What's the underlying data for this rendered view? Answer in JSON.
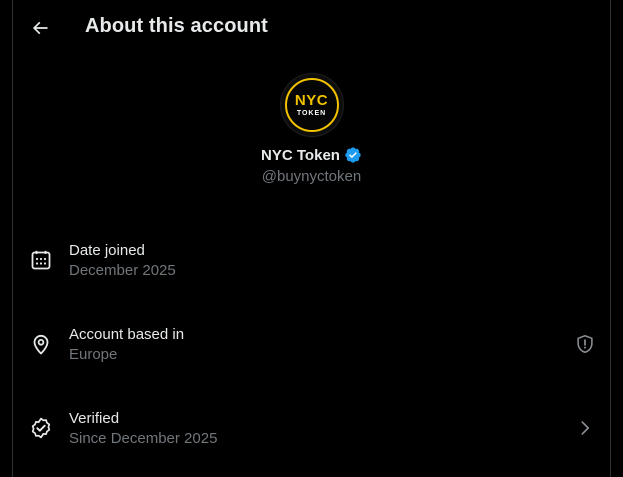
{
  "header": {
    "title": "About this account",
    "back_icon": "arrow-left-icon"
  },
  "profile": {
    "avatar_text_main": "NYC",
    "avatar_text_sub": "TOKEN",
    "avatar_ring_color": "#f2c200",
    "display_name": "NYC Token",
    "verified_badge_color": "#1d9bf0",
    "handle": "@buynyctoken"
  },
  "rows": [
    {
      "icon": "calendar-icon",
      "label": "Date joined",
      "value": "December 2025"
    },
    {
      "icon": "location-pin-icon",
      "label": "Account based in",
      "value": "Europe",
      "right_icon": "shield-alert-icon"
    },
    {
      "icon": "verified-check-icon",
      "label": "Verified",
      "value": "Since December 2025",
      "right_icon": "chevron-right-icon"
    }
  ],
  "colors": {
    "background": "#000000",
    "primary_text": "#e7e9ea",
    "secondary_text": "#71767b",
    "border": "#2f3336"
  }
}
